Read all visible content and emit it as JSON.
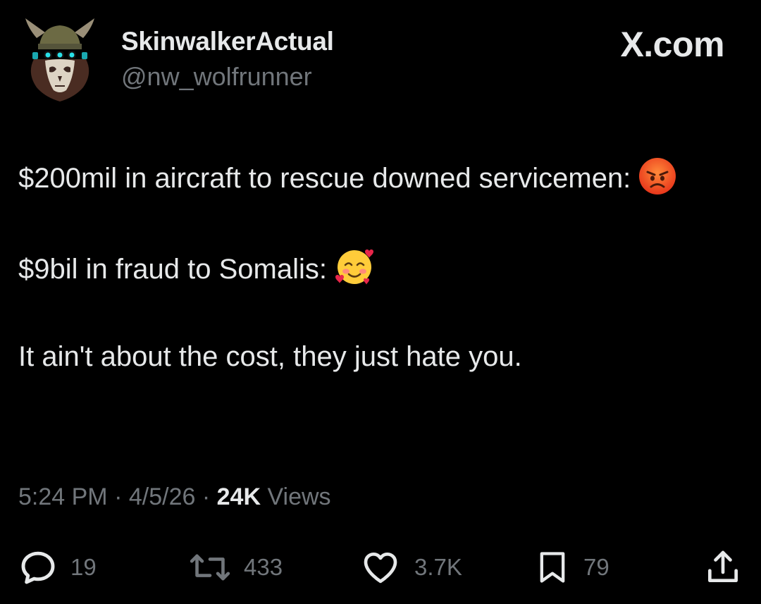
{
  "author": {
    "display_name": "SkinwalkerActual",
    "handle": "@nw_wolfrunner",
    "avatar_icon": "horned-skull-helmet-icon"
  },
  "brand": {
    "label": "X.com"
  },
  "tweet": {
    "paragraphs": [
      {
        "text": "$200mil in aircraft to rescue downed servicemen:",
        "emoji": "angry-face-emoji"
      },
      {
        "text": "$9bil in fraud to Somalis:",
        "emoji": "smiling-face-with-hearts-emoji"
      },
      {
        "text": "It ain't about the cost, they just hate you.",
        "emoji": ""
      }
    ]
  },
  "meta": {
    "time": "5:24 PM",
    "separator": "·",
    "date": "4/5/26",
    "views_count": "24K",
    "views_label": "Views"
  },
  "actions": {
    "reply": {
      "icon": "reply-icon",
      "count": "19"
    },
    "repost": {
      "icon": "repost-icon",
      "count": "433"
    },
    "like": {
      "icon": "heart-icon",
      "count": "3.7K"
    },
    "bookmark": {
      "icon": "bookmark-icon",
      "count": "79"
    },
    "share": {
      "icon": "share-icon"
    }
  },
  "colors": {
    "background": "#000000",
    "primary_text": "#e7e9ea",
    "secondary_text": "#71767b"
  }
}
